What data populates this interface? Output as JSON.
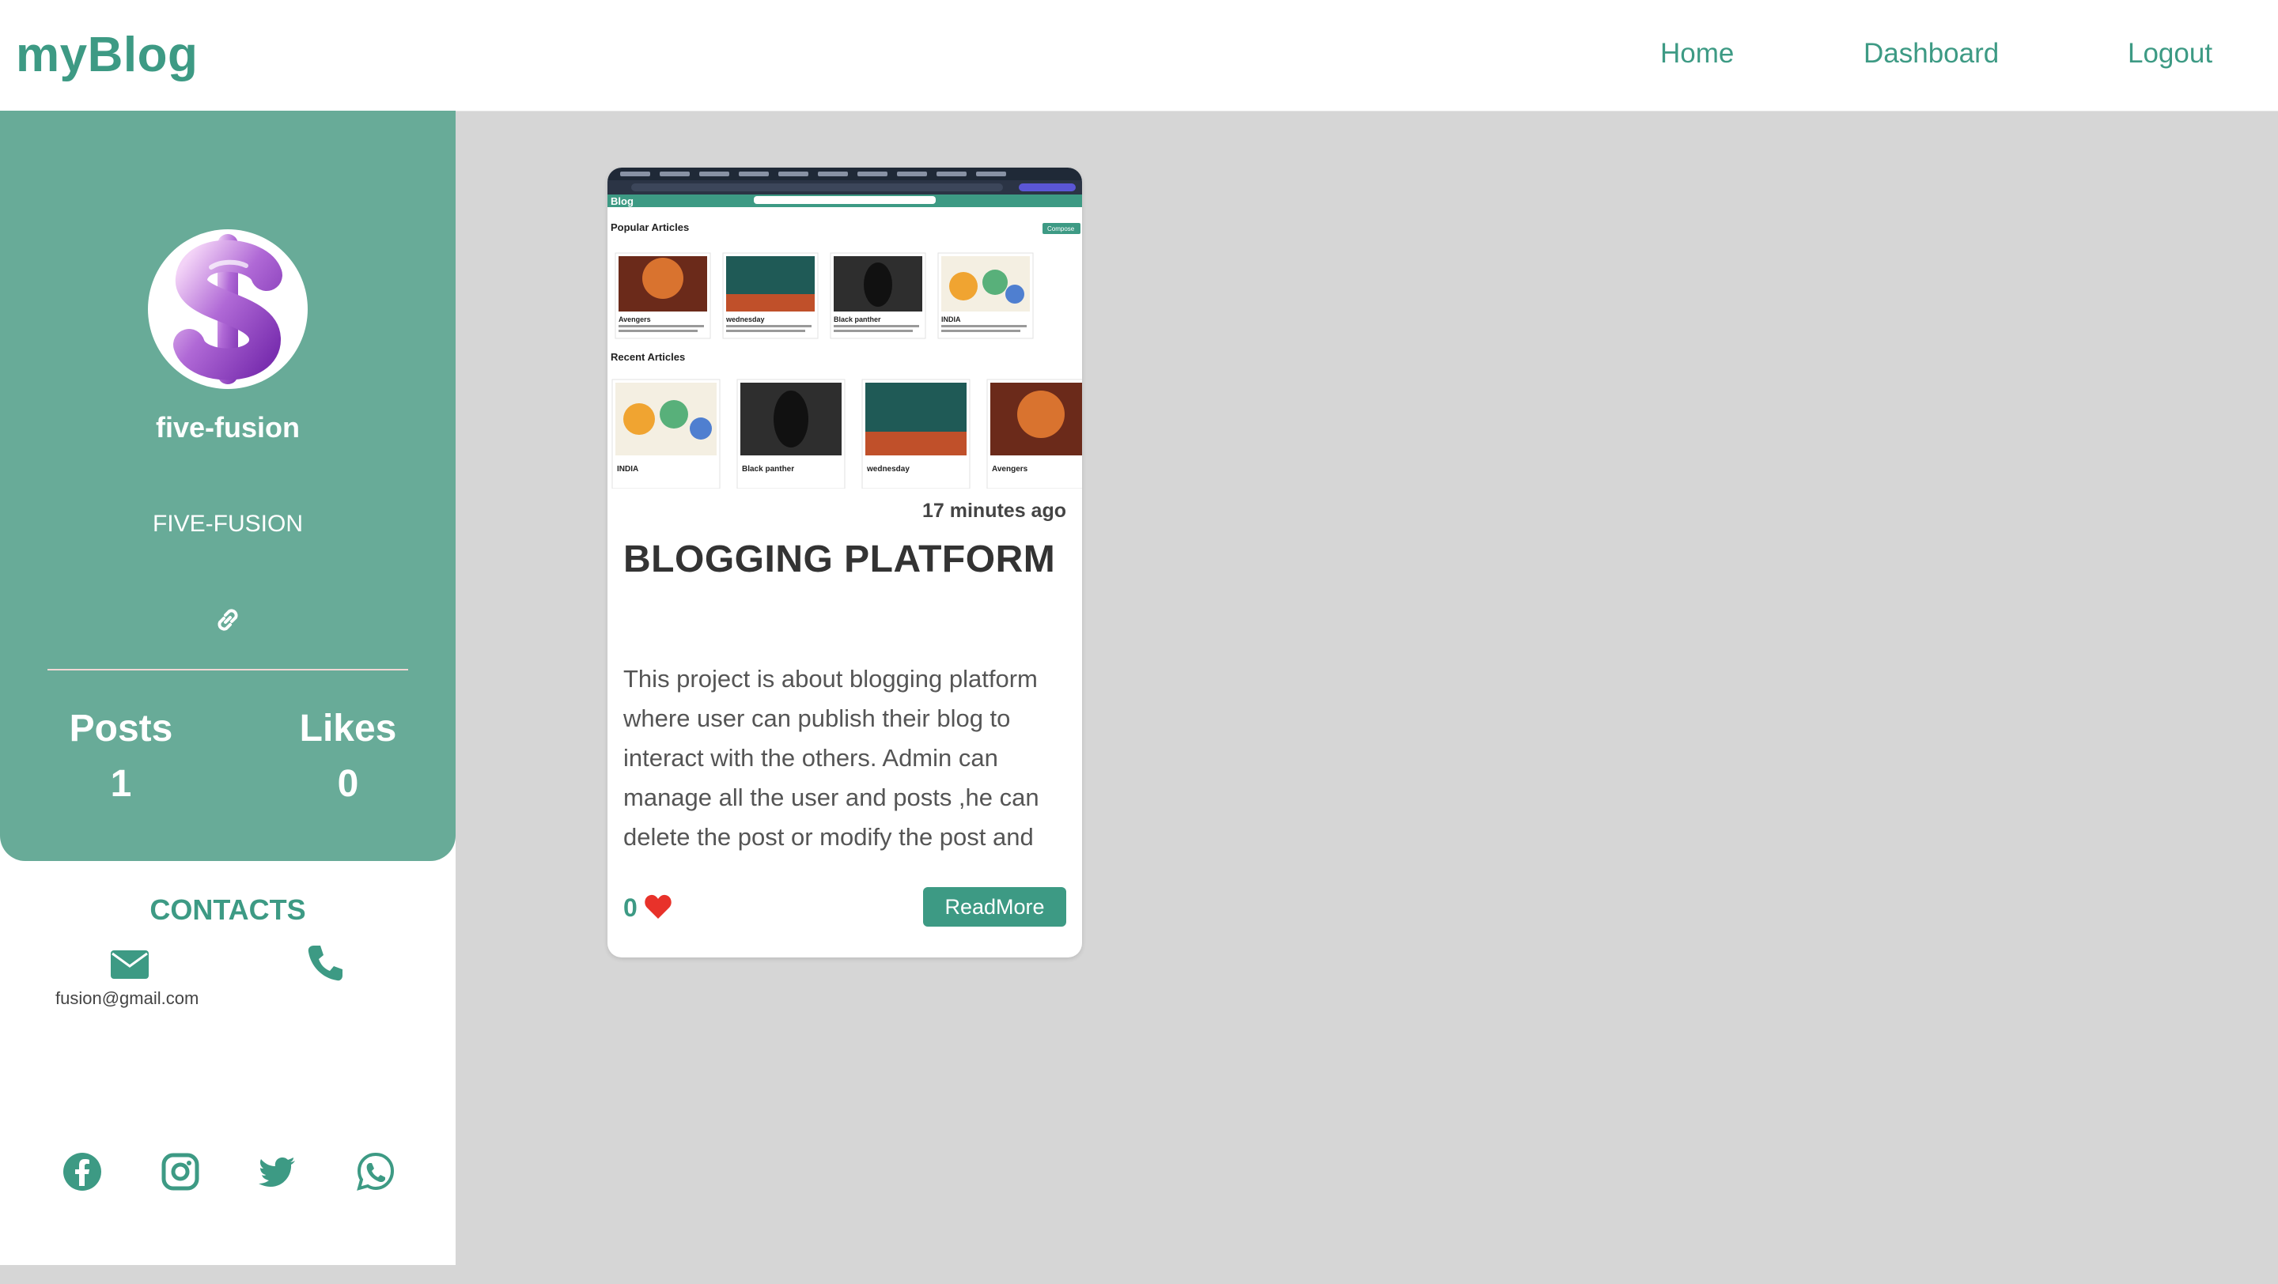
{
  "navbar": {
    "brand": "myBlog",
    "links": [
      "Home",
      "Dashboard",
      "Logout"
    ]
  },
  "profile": {
    "username": "five-fusion",
    "full_name": "FIVE-FUSION",
    "stats": {
      "posts_label": "Posts",
      "posts_value": "1",
      "likes_label": "Likes",
      "likes_value": "0"
    }
  },
  "contacts": {
    "title": "CONTACTS",
    "email": "fusion@gmail.com",
    "social_icons": [
      "facebook-icon",
      "instagram-icon",
      "twitter-icon",
      "whatsapp-icon"
    ]
  },
  "post": {
    "time_ago": "17 minutes ago",
    "title": "BLOGGING PLATFORM",
    "excerpt": "This project is about blogging platform where user can publish their blog to interact with the others. Admin can manage all the user and posts ,he can delete the post or modify the post and",
    "likes": "0",
    "read_more_label": "ReadMore",
    "thumbnail": {
      "brand": "Blog",
      "popular_heading": "Popular Articles",
      "compose_label": "Compose",
      "recent_heading": "Recent Articles",
      "popular_items": [
        "Avengers",
        "wednesday",
        "Black panther",
        "INDIA"
      ],
      "recent_items": [
        "INDIA",
        "Black panther",
        "wednesday",
        "Avengers"
      ]
    }
  },
  "colors": {
    "accent": "#3d9a84",
    "sidebar_card": "#68ab98",
    "page_background": "#d6d6d6",
    "heart": "#e8322a"
  }
}
